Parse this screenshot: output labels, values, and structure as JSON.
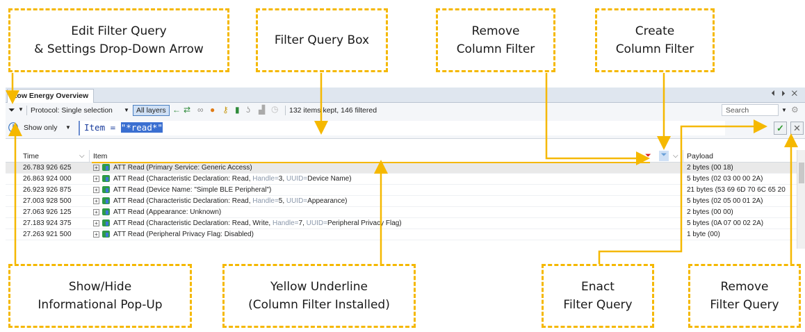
{
  "callouts": {
    "edit_filter": "Edit Filter Query\n& Settings Drop-Down Arrow",
    "filter_box": "Filter Query Box",
    "remove_col": "Remove\nColumn Filter",
    "create_col": "Create\nColumn Filter",
    "show_hide": "Show/Hide\nInformational Pop-Up",
    "yellow_underline": "Yellow Underline\n(Column Filter Installed)",
    "enact": "Enact\nFilter Query",
    "remove_query": "Remove\nFilter Query"
  },
  "window": {
    "tab_title": "Low Energy Overview",
    "controls": "⏴ ⏵ ✕"
  },
  "toolbar": {
    "filter_icon": "funnel-icon",
    "protocol_label": "Protocol: Single selection",
    "all_layers": "All layers",
    "status": "132 items kept, 146 filtered",
    "search_label": "Search"
  },
  "filterbar": {
    "show_only": "Show only",
    "query_prefix": "Item = ",
    "query_selected": "\"*read*\""
  },
  "columns": {
    "time": "Time",
    "item": "Item",
    "payload": "Payload"
  },
  "rows": [
    {
      "time": "26.783 926 625",
      "item": "ATT Read (Primary Service:  Generic Access)",
      "payload": "2 bytes (00 18)"
    },
    {
      "time": "26.863 924 000",
      "item_a": "ATT Read (Characteristic Declaration: Read, ",
      "item_b": "Handle=",
      "item_c": "3, ",
      "item_d": "UUID=",
      "item_e": "Device Name)",
      "payload": "5 bytes (02 03 00 00 2A)"
    },
    {
      "time": "26.923 926 875",
      "item": "ATT Read (Device Name: \"Simple BLE Peripheral\")",
      "payload": "21 bytes (53 69 6D 70 6C 65 20"
    },
    {
      "time": "27.003 928 500",
      "item_a": "ATT Read (Characteristic Declaration: Read, ",
      "item_b": "Handle=",
      "item_c": "5, ",
      "item_d": "UUID=",
      "item_e": "Appearance)",
      "payload": "5 bytes (02 05 00 01 2A)"
    },
    {
      "time": "27.063 926 125",
      "item": "ATT Read (Appearance: Unknown)",
      "payload": "2 bytes (00 00)"
    },
    {
      "time": "27.183 924 375",
      "item_a": "ATT Read (Characteristic Declaration: Read, Write, ",
      "item_b": "Handle=",
      "item_c": "7, ",
      "item_d": "UUID=",
      "item_e": "Peripheral Privacy Flag)",
      "payload": "5 bytes (0A 07 00 02 2A)"
    },
    {
      "time": "27.263 921 500",
      "item": "ATT Read (Peripheral Privacy Flag: Disabled)",
      "payload": "1 byte (00)"
    }
  ],
  "colors": {
    "callout_border": "#f5b800",
    "connector": "#f5b800",
    "selection": "#3a6fd1"
  }
}
